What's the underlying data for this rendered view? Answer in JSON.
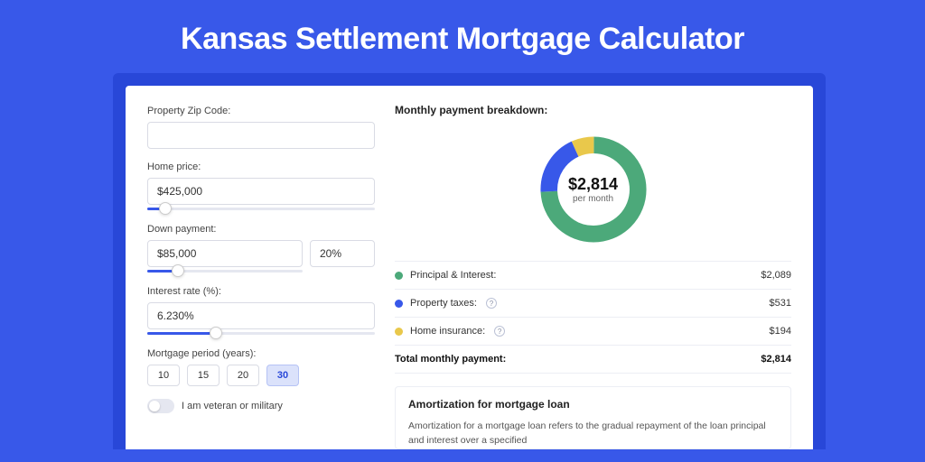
{
  "title": "Kansas Settlement Mortgage Calculator",
  "form": {
    "zip": {
      "label": "Property Zip Code:",
      "value": ""
    },
    "home_price": {
      "label": "Home price:",
      "value": "$425,000",
      "slider_pct": 8
    },
    "down_payment": {
      "label": "Down payment:",
      "amount": "$85,000",
      "percent": "20%",
      "slider_pct": 20
    },
    "interest_rate": {
      "label": "Interest rate (%):",
      "value": "6.230%",
      "slider_pct": 30
    },
    "period": {
      "label": "Mortgage period (years):",
      "options": [
        "10",
        "15",
        "20",
        "30"
      ],
      "active": "30"
    },
    "veteran": {
      "label": "I am veteran or military",
      "on": false
    }
  },
  "breakdown": {
    "title": "Monthly payment breakdown:",
    "total_value": "$2,814",
    "total_sub": "per month",
    "items": [
      {
        "label": "Principal & Interest:",
        "value": "$2,089",
        "color": "green",
        "info": false
      },
      {
        "label": "Property taxes:",
        "value": "$531",
        "color": "blue",
        "info": true
      },
      {
        "label": "Home insurance:",
        "value": "$194",
        "color": "yellow",
        "info": true
      }
    ],
    "total_row": {
      "label": "Total monthly payment:",
      "value": "$2,814"
    }
  },
  "chart_data": {
    "type": "pie",
    "title": "Monthly payment breakdown",
    "series": [
      {
        "name": "Principal & Interest",
        "value": 2089,
        "color": "#4ca97a"
      },
      {
        "name": "Property taxes",
        "value": 531,
        "color": "#3858e9"
      },
      {
        "name": "Home insurance",
        "value": 194,
        "color": "#e9c84b"
      }
    ],
    "total": 2814,
    "center_label": "$2,814",
    "center_sub": "per month"
  },
  "amortization": {
    "title": "Amortization for mortgage loan",
    "text": "Amortization for a mortgage loan refers to the gradual repayment of the loan principal and interest over a specified"
  }
}
